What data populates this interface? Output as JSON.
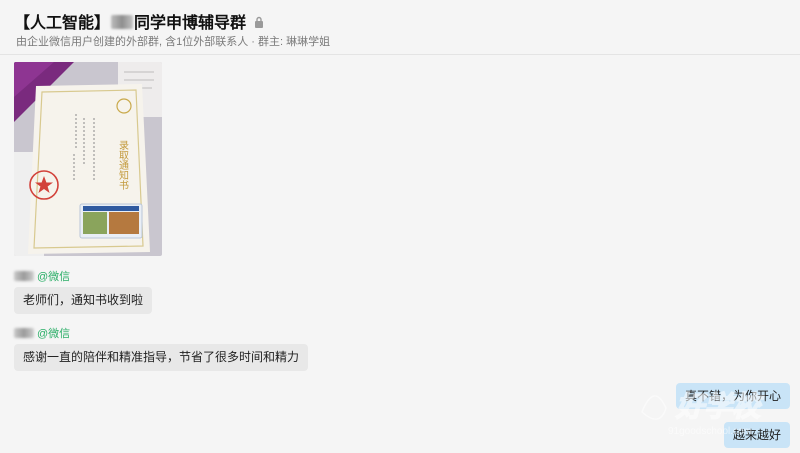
{
  "header": {
    "title_prefix": "【人工智能】",
    "title_suffix": "同学申博辅导群",
    "subtitle": "由企业微信用户创建的外部群, 含1位外部联系人 · 群主: 琳琳学姐"
  },
  "messages": {
    "photo": {
      "letter_title": "录取通知书"
    },
    "m1": {
      "sender_tag": "@微信",
      "text": "老师们，通知书收到啦"
    },
    "m2": {
      "sender_tag": "@微信",
      "text": "感谢一直的陪伴和精准指导，节省了很多时间和精力"
    },
    "r1": {
      "text": "真不错，为你开心"
    },
    "r2": {
      "text": "越来越好"
    }
  },
  "watermark": {
    "logo_text": "好学校",
    "url": "91goodschool.com"
  },
  "colors": {
    "background": "#f5f5f5",
    "sender_tag": "#2aae67",
    "incoming_bubble": "#e8e8e8",
    "outgoing_bubble": "#c9e4f7"
  },
  "icons": [
    "lock-icon",
    "seal-icon",
    "star-icon"
  ]
}
